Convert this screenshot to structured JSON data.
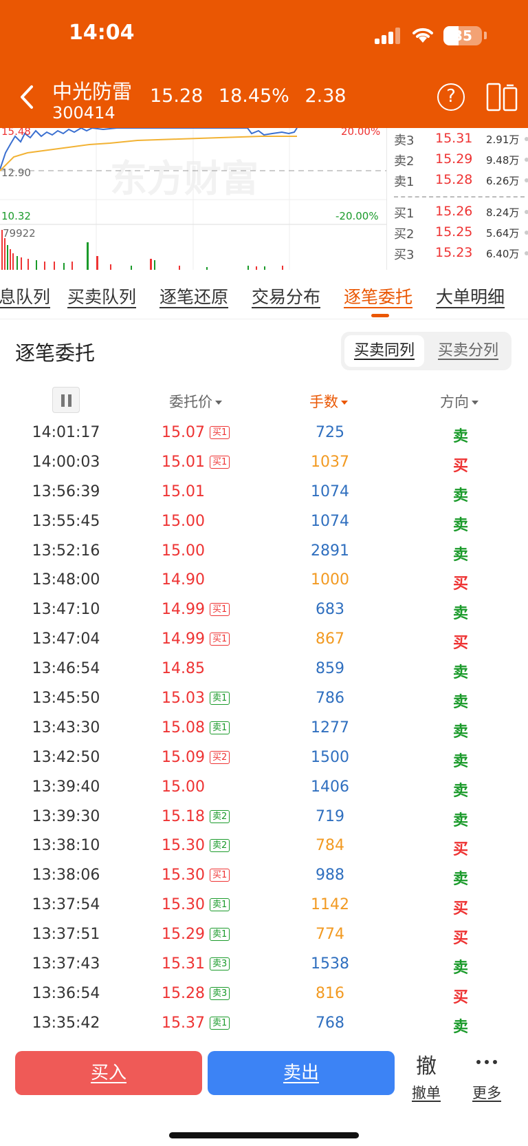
{
  "status_bar": {
    "time": "14:04",
    "battery": "35"
  },
  "header": {
    "stock_name": "中光防雷",
    "stock_code": "300414",
    "price": "15.28",
    "change_pct": "18.45%",
    "change": "2.38"
  },
  "chart": {
    "top_price": "15.48",
    "mid_price": "12.90",
    "low_price": "10.32",
    "top_pct": "20.00%",
    "low_pct": "-20.00%",
    "volume_max": "79922",
    "watermark": "东方财富"
  },
  "orderbook": {
    "asks": [
      {
        "label": "卖3",
        "price": "15.31",
        "volume": "2.91万"
      },
      {
        "label": "卖2",
        "price": "15.29",
        "volume": "9.48万"
      },
      {
        "label": "卖1",
        "price": "15.28",
        "volume": "6.26万"
      }
    ],
    "bids": [
      {
        "label": "买1",
        "price": "15.26",
        "volume": "8.24万"
      },
      {
        "label": "买2",
        "price": "15.25",
        "volume": "5.64万"
      },
      {
        "label": "买3",
        "price": "15.23",
        "volume": "6.40万"
      }
    ]
  },
  "tabs": [
    "息队列",
    "买卖队列",
    "逐笔还原",
    "交易分布",
    "逐笔委托",
    "大单明细"
  ],
  "section": {
    "title": "逐笔委托",
    "toggle_same": "买卖同列",
    "toggle_split": "买卖分列"
  },
  "columns": {
    "price": "委托价",
    "qty": "手数",
    "direction": "方向"
  },
  "rows": [
    {
      "time": "14:01:17",
      "price": "15.07",
      "tag": "买1",
      "qty": "725",
      "dir": "卖"
    },
    {
      "time": "14:00:03",
      "price": "15.01",
      "tag": "买1",
      "qty": "1037",
      "dir": "买"
    },
    {
      "time": "13:56:39",
      "price": "15.01",
      "tag": "",
      "qty": "1074",
      "dir": "卖"
    },
    {
      "time": "13:55:45",
      "price": "15.00",
      "tag": "",
      "qty": "1074",
      "dir": "卖"
    },
    {
      "time": "13:52:16",
      "price": "15.00",
      "tag": "",
      "qty": "2891",
      "dir": "卖"
    },
    {
      "time": "13:48:00",
      "price": "14.90",
      "tag": "",
      "qty": "1000",
      "dir": "买"
    },
    {
      "time": "13:47:10",
      "price": "14.99",
      "tag": "买1",
      "qty": "683",
      "dir": "卖"
    },
    {
      "time": "13:47:04",
      "price": "14.99",
      "tag": "买1",
      "qty": "867",
      "dir": "买"
    },
    {
      "time": "13:46:54",
      "price": "14.85",
      "tag": "",
      "qty": "859",
      "dir": "卖"
    },
    {
      "time": "13:45:50",
      "price": "15.03",
      "tag": "卖1",
      "qty": "786",
      "dir": "卖"
    },
    {
      "time": "13:43:30",
      "price": "15.08",
      "tag": "卖1",
      "qty": "1277",
      "dir": "卖"
    },
    {
      "time": "13:42:50",
      "price": "15.09",
      "tag": "买2",
      "qty": "1500",
      "dir": "卖"
    },
    {
      "time": "13:39:40",
      "price": "15.00",
      "tag": "",
      "qty": "1406",
      "dir": "卖"
    },
    {
      "time": "13:39:30",
      "price": "15.18",
      "tag": "卖2",
      "qty": "719",
      "dir": "卖"
    },
    {
      "time": "13:38:10",
      "price": "15.30",
      "tag": "卖2",
      "qty": "784",
      "dir": "买"
    },
    {
      "time": "13:38:06",
      "price": "15.30",
      "tag": "买1",
      "qty": "988",
      "dir": "卖"
    },
    {
      "time": "13:37:54",
      "price": "15.30",
      "tag": "卖1",
      "qty": "1142",
      "dir": "买"
    },
    {
      "time": "13:37:51",
      "price": "15.29",
      "tag": "卖1",
      "qty": "774",
      "dir": "买"
    },
    {
      "time": "13:37:43",
      "price": "15.31",
      "tag": "卖3",
      "qty": "1538",
      "dir": "卖"
    },
    {
      "time": "13:36:54",
      "price": "15.28",
      "tag": "卖3",
      "qty": "816",
      "dir": "买"
    },
    {
      "time": "13:35:42",
      "price": "15.37",
      "tag": "卖1",
      "qty": "768",
      "dir": "卖"
    }
  ],
  "bottom_bar": {
    "buy": "买入",
    "sell": "卖出",
    "cancel_glyph": "撤",
    "cancel": "撤单",
    "more": "更多"
  },
  "colors": {
    "brand": "#ea5703",
    "up": "#e33333",
    "down": "#1a9a2a",
    "qty_sell": "#2f6fbf",
    "qty_buy": "#f29a22"
  }
}
